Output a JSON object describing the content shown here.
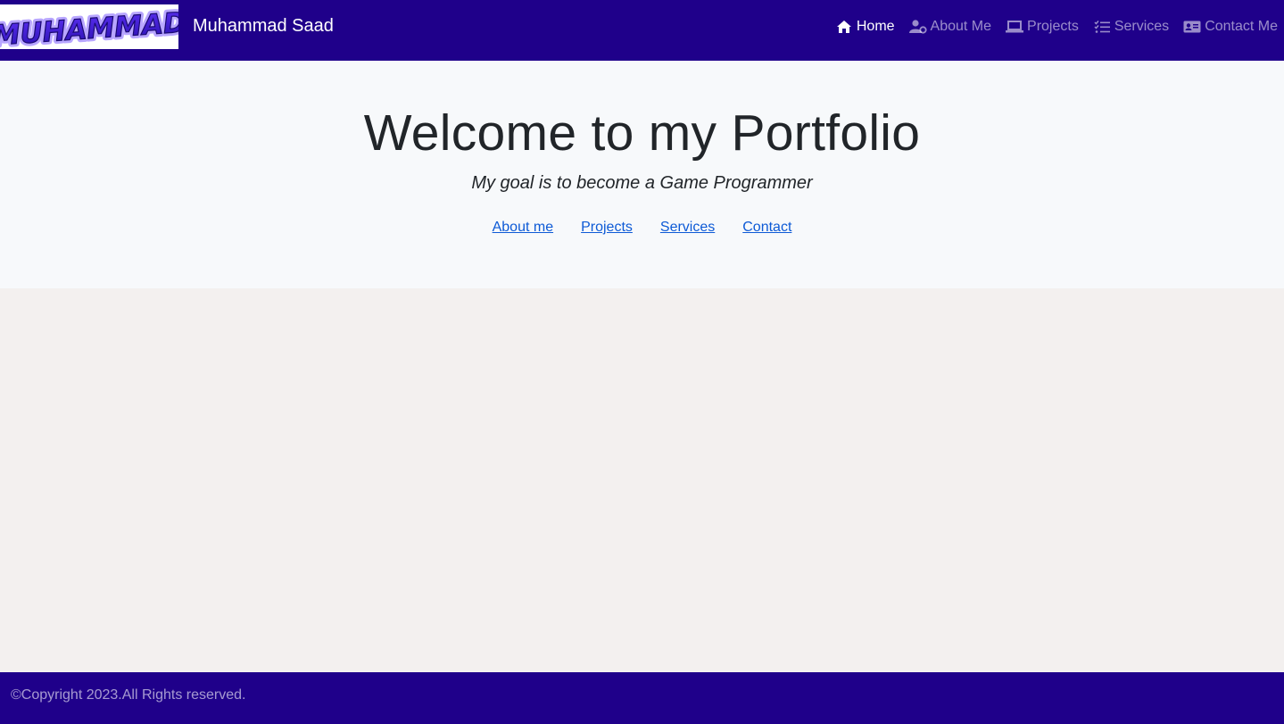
{
  "logo": {
    "text": "MUHAMMAD",
    "color": "#4b23d6"
  },
  "navbar": {
    "brand": "Muhammad Saad",
    "background": "#1f008a",
    "links": [
      {
        "label": "Home",
        "icon": "home-icon",
        "active": true
      },
      {
        "label": "About Me",
        "icon": "user-gear-icon",
        "active": false
      },
      {
        "label": "Projects",
        "icon": "laptop-icon",
        "active": false
      },
      {
        "label": "Services",
        "icon": "checklist-icon",
        "active": false
      },
      {
        "label": "Contact Me",
        "icon": "address-card-icon",
        "active": false
      }
    ]
  },
  "hero": {
    "title": "Welcome to my Portfolio",
    "subtitle": "My goal is to become a Game Programmer",
    "links": [
      {
        "label": "About me"
      },
      {
        "label": "Projects"
      },
      {
        "label": "Services"
      },
      {
        "label": "Contact"
      }
    ],
    "link_color": "#0d5ad6"
  },
  "footer": {
    "text": "©Copyright 2023.All Rights reserved."
  }
}
